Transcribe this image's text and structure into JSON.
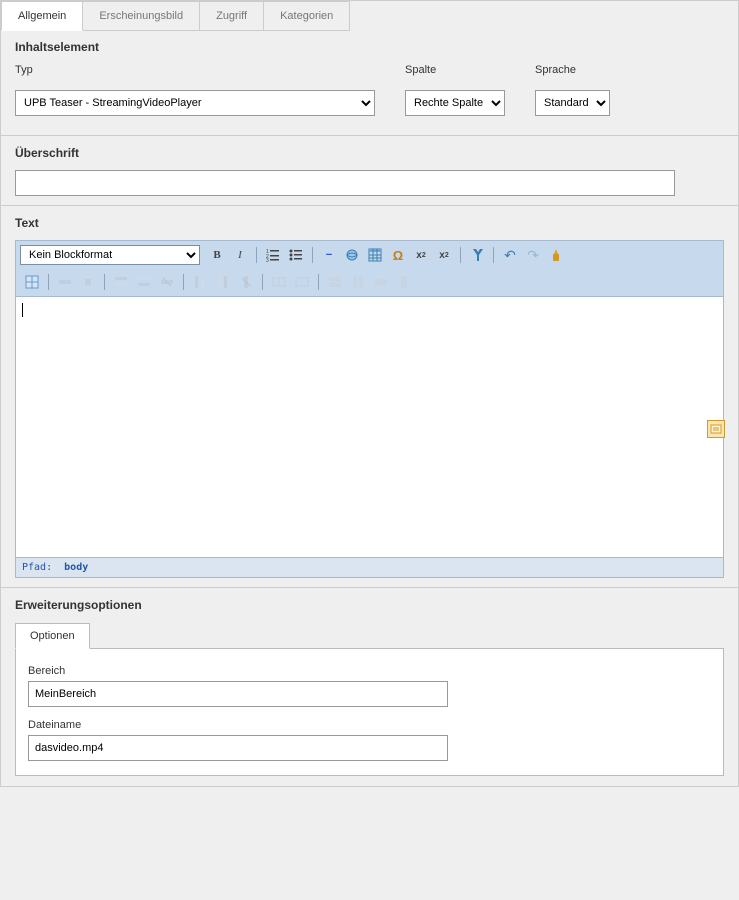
{
  "tabs": {
    "general": "Allgemein",
    "appearance": "Erscheinungsbild",
    "access": "Zugriff",
    "categories": "Kategorien"
  },
  "content_element": {
    "title": "Inhaltselement",
    "type_label": "Typ",
    "type_value": "UPB Teaser - StreamingVideoPlayer",
    "column_label": "Spalte",
    "column_value": "Rechte Spalte",
    "language_label": "Sprache",
    "language_value": "Standard"
  },
  "heading": {
    "title": "Überschrift",
    "value": ""
  },
  "text": {
    "title": "Text",
    "block_format": "Kein Blockformat",
    "path_label": "Pfad:",
    "path_value": "body",
    "content": ""
  },
  "extension": {
    "title": "Erweiterungsoptionen",
    "options_tab": "Optionen",
    "area_label": "Bereich",
    "area_value": "MeinBereich",
    "filename_label": "Dateiname",
    "filename_value": "dasvideo.mp4"
  },
  "icons": {
    "bold": "B",
    "italic": "I",
    "ordered_list": "ol",
    "unordered_list": "ul",
    "hr": "—",
    "link": "link",
    "table": "table",
    "omega": "Ω",
    "subscript": "x₂",
    "superscript": "x²",
    "find": "find",
    "undo": "↶",
    "redo": "↷",
    "cleanup": "clean"
  }
}
